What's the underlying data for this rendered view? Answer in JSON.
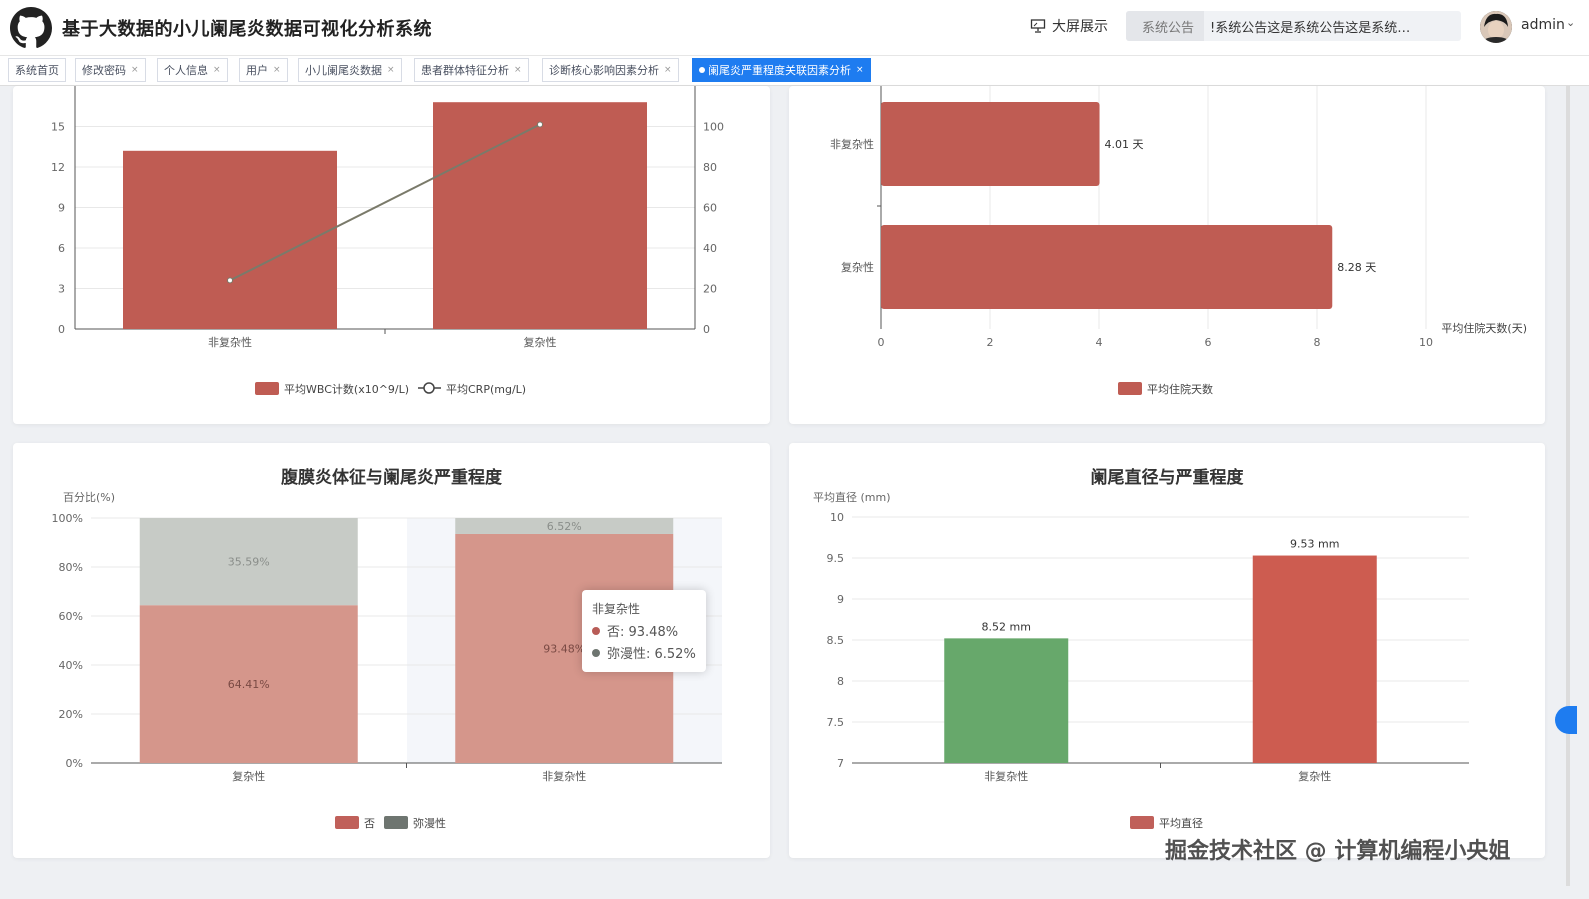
{
  "header": {
    "title": "基于大数据的小儿阑尾炎数据可视化分析系统",
    "screen_label": "大屏展示",
    "notice_label": "系统公告",
    "notice_text": "!系统公告这是系统公告这是系统…",
    "user": "admin"
  },
  "tabs": [
    {
      "label": "系统首页"
    },
    {
      "label": "修改密码"
    },
    {
      "label": "个人信息"
    },
    {
      "label": "用户"
    },
    {
      "label": "小儿阑尾炎数据"
    },
    {
      "label": "患者群体特征分析"
    },
    {
      "label": "诊断核心影响因素分析"
    },
    {
      "label": "阑尾炎严重程度关联因素分析"
    }
  ],
  "tooltip": {
    "title": "非复杂性",
    "rows": [
      {
        "label": "否: 93.48%",
        "color": "#b85c57"
      },
      {
        "label": "弥漫性: 6.52%",
        "color": "#6e7570"
      }
    ]
  },
  "watermark": "掘金技术社区 @ 计算机编程小央姐",
  "chart_data": [
    {
      "type": "bar",
      "categories": [
        "非复杂性",
        "复杂性"
      ],
      "series": [
        {
          "name": "平均WBC计数(x10^9/L)",
          "values": [
            13.2,
            16.8
          ],
          "color": "#bf5c53"
        },
        {
          "name": "平均CRP(mg/L)",
          "values": [
            24,
            101
          ],
          "type": "line",
          "axis": "right",
          "color": "#7a7a6a"
        }
      ],
      "y_left": {
        "ticks": [
          "0",
          "3",
          "6",
          "9",
          "12",
          "15"
        ],
        "range": [
          0,
          18
        ]
      },
      "y_right": {
        "ticks": [
          "0",
          "20",
          "40",
          "60",
          "80",
          "100"
        ],
        "range": [
          0,
          120
        ]
      },
      "legend_position": "bottom"
    },
    {
      "type": "bar",
      "orientation": "horizontal",
      "categories": [
        "非复杂性",
        "复杂性"
      ],
      "series": [
        {
          "name": "平均住院天数",
          "values": [
            4.01,
            8.28
          ],
          "color": "#bf5c53"
        }
      ],
      "data_labels": [
        "4.01 天",
        "8.28 天"
      ],
      "xlabel": "平均住院天数(天)",
      "x_ticks": [
        "0",
        "2",
        "4",
        "6",
        "8",
        "10"
      ],
      "xlim": [
        0,
        10
      ],
      "legend_position": "bottom"
    },
    {
      "type": "bar",
      "stacked": true,
      "title": "腹膜炎体征与阑尾炎严重程度",
      "ylabel": "百分比(%)",
      "categories": [
        "复杂性",
        "非复杂性"
      ],
      "series": [
        {
          "name": "否",
          "values": [
            64.41,
            93.48
          ],
          "labels": [
            "64.41%",
            "93.48%"
          ],
          "color": "#d5968b"
        },
        {
          "name": "弥漫性",
          "values": [
            35.59,
            6.52
          ],
          "labels": [
            "35.59%",
            "6.52%"
          ],
          "color": "#c7cbc6"
        }
      ],
      "y_ticks": [
        "0%",
        "20%",
        "40%",
        "60%",
        "80%",
        "100%"
      ],
      "ylim": [
        0,
        100
      ],
      "legend_colors": [
        "#c0605a",
        "#6e7570"
      ],
      "legend_position": "bottom"
    },
    {
      "type": "bar",
      "title": "阑尾直径与严重程度",
      "ylabel": "平均直径 (mm)",
      "categories": [
        "非复杂性",
        "复杂性"
      ],
      "series": [
        {
          "name": "平均直径",
          "values": [
            8.52,
            9.53
          ],
          "colors": [
            "#67a86b",
            "#cd5c50"
          ]
        }
      ],
      "data_labels": [
        "8.52 mm",
        "9.53 mm"
      ],
      "y_ticks": [
        "7",
        "7.5",
        "8",
        "8.5",
        "9",
        "9.5",
        "10"
      ],
      "ylim": [
        7,
        10
      ],
      "legend_color": "#c0605a",
      "legend_position": "bottom"
    }
  ]
}
